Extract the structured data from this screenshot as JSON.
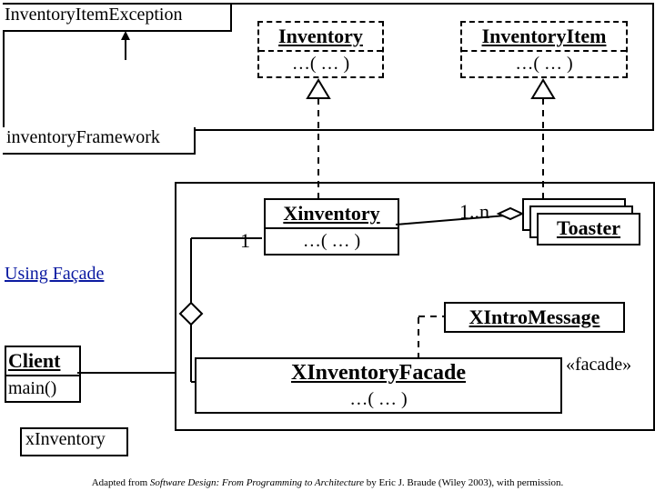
{
  "topPackage": {
    "exception": "InventoryItemException",
    "inventory": {
      "name": "Inventory",
      "method": "…( … )"
    },
    "inventoryItem": {
      "name": "InventoryItem",
      "method": "…( … )"
    },
    "label": "inventoryFramework"
  },
  "bottomPackage": {
    "xinventory": {
      "name": "Xinventory",
      "method": "…( … )"
    },
    "multLeft": "1",
    "multRight": "1..n",
    "toaster": "Toaster",
    "intro": "XIntroMessage",
    "facade": {
      "name": "XInventoryFacade",
      "method": "…( … )"
    },
    "stereotype": "«facade»",
    "client": {
      "name": "Client",
      "method": "main()"
    },
    "label": "xInventory"
  },
  "link": "Using Façade",
  "credit": {
    "prefix": "Adapted from ",
    "title": "Software Design: From Programming to Architecture",
    "suffix": " by Eric J. Braude (Wiley 2003), with permission."
  }
}
